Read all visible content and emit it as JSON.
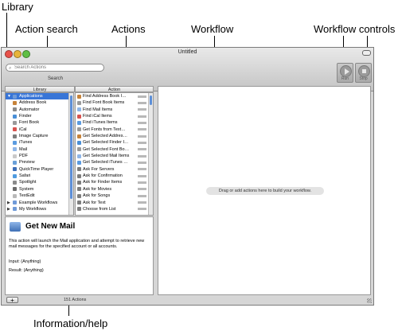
{
  "callouts": {
    "library": "Library",
    "action_search": "Action search",
    "actions": "Actions",
    "workflow": "Workflow",
    "workflow_controls": "Workflow controls",
    "information_help": "Information/help"
  },
  "window": {
    "title": "Untitled",
    "search_placeholder": "Search Actions",
    "search_label": "Search",
    "controls": [
      {
        "label": "Run",
        "icon": "play-icon"
      },
      {
        "label": "Stop",
        "icon": "stop-icon"
      }
    ],
    "library_header": "Library",
    "actions_header": "Action",
    "library_items": [
      {
        "label": "Applications",
        "icon": "folder-icon",
        "selected": true,
        "expanded": true
      },
      {
        "label": "Address Book",
        "icon": "address-book-icon"
      },
      {
        "label": "Automator",
        "icon": "automator-icon"
      },
      {
        "label": "Finder",
        "icon": "finder-icon"
      },
      {
        "label": "Font Book",
        "icon": "font-book-icon"
      },
      {
        "label": "iCal",
        "icon": "ical-icon"
      },
      {
        "label": "Image Capture",
        "icon": "image-capture-icon"
      },
      {
        "label": "iTunes",
        "icon": "itunes-icon"
      },
      {
        "label": "Mail",
        "icon": "mail-icon"
      },
      {
        "label": "PDF",
        "icon": "pdf-icon"
      },
      {
        "label": "Preview",
        "icon": "preview-icon"
      },
      {
        "label": "QuickTime Player",
        "icon": "quicktime-icon"
      },
      {
        "label": "Safari",
        "icon": "safari-icon"
      },
      {
        "label": "Spotlight",
        "icon": "spotlight-icon"
      },
      {
        "label": "System",
        "icon": "system-icon"
      },
      {
        "label": "TextEdit",
        "icon": "textedit-icon"
      },
      {
        "label": "Example Workflows",
        "icon": "folder-icon",
        "expanded": false
      },
      {
        "label": "My Workflows",
        "icon": "folder-icon",
        "expanded": false
      }
    ],
    "action_items": [
      {
        "label": "Find Address Book I…"
      },
      {
        "label": "Find Font Book Items"
      },
      {
        "label": "Find Mail Items"
      },
      {
        "label": "Find iCal Items"
      },
      {
        "label": "Find iTunes Items"
      },
      {
        "label": "Get Fonts from Text…"
      },
      {
        "label": "Get Selected Addres…"
      },
      {
        "label": "Get Selected Finder I…"
      },
      {
        "label": "Get Selected Font Bo…"
      },
      {
        "label": "Get Selected Mail Items"
      },
      {
        "label": "Get Selected iTunes …"
      },
      {
        "label": "Ask For Servers"
      },
      {
        "label": "Ask for Confirmation"
      },
      {
        "label": "Ask for Finder Items"
      },
      {
        "label": "Ask for Movies"
      },
      {
        "label": "Ask for Songs"
      },
      {
        "label": "Ask for Text"
      },
      {
        "label": "Choose from List"
      }
    ],
    "info": {
      "title": "Get New Mail",
      "description": "This action will launch the Mail application and attempt to retrieve new mail messages for the specified account or all accounts.",
      "input": "Input: (Anything)",
      "result": "Result: (Anything)"
    },
    "workflow_hint": "Drag or add actions here to build your workflow.",
    "add_button": "+",
    "actions_count": "151 Actions"
  },
  "colors": {
    "selection": "#3875d7",
    "window_bg": "#d6d6d6",
    "traffic_red": "#e8514a",
    "traffic_yellow": "#e7b43a",
    "traffic_green": "#5fbf45"
  }
}
